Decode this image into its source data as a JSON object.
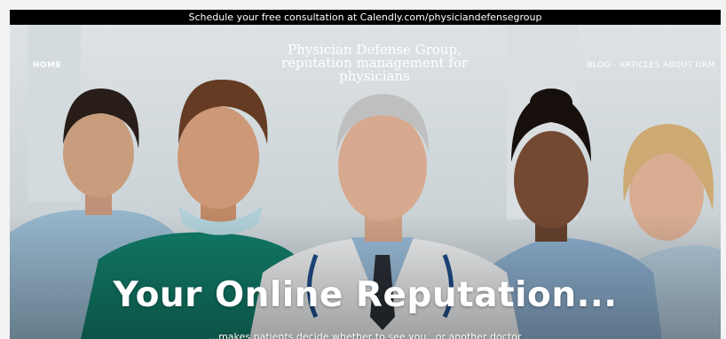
{
  "announcement": "Schedule your free consultation at Calendly.com/physiciandefensegroup",
  "nav": {
    "home": "HOME",
    "blog": "BLOG - ARTICLES ABOUT ORM"
  },
  "site_title": "Physician Defense Group, reputation management for physicians",
  "hero": {
    "headline": "Your Online Reputation...",
    "subline": "...makes patients decide whether to see you...or another doctor",
    "image": "medical-team-photo"
  },
  "colors": {
    "announcement_bg": "#000000",
    "scrubs_teal": "#12806c",
    "scrubs_blue": "#9cc0d8",
    "text": "#ffffff"
  }
}
